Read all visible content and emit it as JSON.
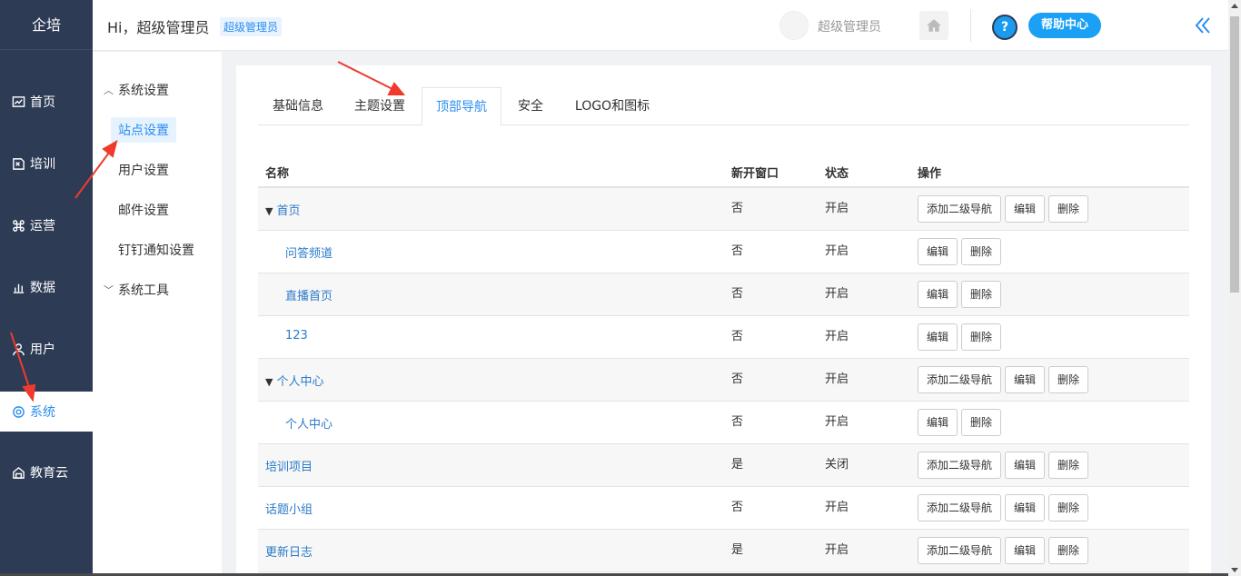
{
  "brand": "企培",
  "sidebar": {
    "items": [
      {
        "label": "首页",
        "icon": "chart-line-icon"
      },
      {
        "label": "培训",
        "icon": "book-icon"
      },
      {
        "label": "运营",
        "icon": "command-icon"
      },
      {
        "label": "数据",
        "icon": "bar-chart-icon"
      },
      {
        "label": "用户",
        "icon": "user-icon"
      },
      {
        "label": "系统",
        "icon": "gear-icon",
        "active": true
      },
      {
        "label": "教育云",
        "icon": "cloud-icon"
      }
    ]
  },
  "header": {
    "greeting": "Hi，超级管理员",
    "role_badge": "超级管理员",
    "user_name": "超级管理员",
    "help_label": "帮助中心",
    "help_icon_text": "?"
  },
  "submenu": {
    "group1": "系统设置",
    "items": [
      "站点设置",
      "用户设置",
      "邮件设置",
      "钉钉通知设置"
    ],
    "group2": "系统工具"
  },
  "tabs": [
    "基础信息",
    "主题设置",
    "顶部导航",
    "安全",
    "LOGO和图标"
  ],
  "active_tab": "顶部导航",
  "table": {
    "headers": {
      "name": "名称",
      "new_window": "新开窗口",
      "status": "状态",
      "ops": "操作"
    },
    "buttons": {
      "add_sub": "添加二级导航",
      "edit": "编辑",
      "delete": "删除"
    },
    "rows": [
      {
        "name": "首页",
        "new_window": "否",
        "status": "开启",
        "level": "parent-expanded"
      },
      {
        "name": "问答频道",
        "new_window": "否",
        "status": "开启",
        "level": "child"
      },
      {
        "name": "直播首页",
        "new_window": "否",
        "status": "开启",
        "level": "child"
      },
      {
        "name": "123",
        "new_window": "否",
        "status": "开启",
        "level": "child"
      },
      {
        "name": "个人中心",
        "new_window": "否",
        "status": "开启",
        "level": "parent-expanded"
      },
      {
        "name": "个人中心",
        "new_window": "否",
        "status": "开启",
        "level": "child"
      },
      {
        "name": "培训项目",
        "new_window": "是",
        "status": "关闭",
        "level": "top"
      },
      {
        "name": "话题小组",
        "new_window": "否",
        "status": "开启",
        "level": "top"
      },
      {
        "name": "更新日志",
        "new_window": "是",
        "status": "开启",
        "level": "top"
      }
    ]
  },
  "colors": {
    "sidebar_bg": "#2d3b55",
    "accent": "#2b8ef0",
    "help_bg": "#1aa0f5",
    "annotation_arrow": "#f03a2e"
  }
}
